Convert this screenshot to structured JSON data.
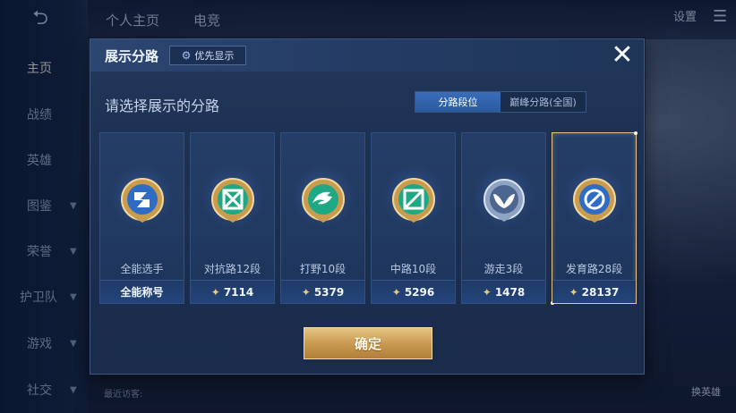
{
  "sidebar": {
    "items": [
      {
        "label": "主页",
        "active": true
      },
      {
        "label": "战绩"
      },
      {
        "label": "英雄"
      },
      {
        "label": "图鉴"
      },
      {
        "label": "荣誉"
      },
      {
        "label": "护卫队"
      },
      {
        "label": "游戏"
      },
      {
        "label": "社交"
      }
    ]
  },
  "top": {
    "tabs": [
      "个人主页",
      "电竞"
    ],
    "settings": "设置",
    "swap_hero": "换英雄",
    "visitors": "最近访客:"
  },
  "modal": {
    "title": "展示分路",
    "priority_label": "优先显示",
    "close_icon": "close-icon",
    "subtitle": "请选择展示的分路",
    "segment": {
      "options": [
        "分路段位",
        "巅峰分路(全国)"
      ],
      "selected": "分路段位"
    },
    "lanes": [
      {
        "name": "全能选手",
        "footer": "全能称号",
        "has_star": false,
        "icon": "allround-badge-icon",
        "color": "#3a78d0"
      },
      {
        "name": "对抗路12段",
        "footer": "7114",
        "has_star": true,
        "icon": "clash-lane-badge-icon",
        "color": "#23b08e"
      },
      {
        "name": "打野10段",
        "footer": "5379",
        "has_star": true,
        "icon": "jungle-badge-icon",
        "color": "#23b08e"
      },
      {
        "name": "中路10段",
        "footer": "5296",
        "has_star": true,
        "icon": "mid-lane-badge-icon",
        "color": "#23b08e"
      },
      {
        "name": "游走3段",
        "footer": "1478",
        "has_star": true,
        "icon": "roam-badge-icon",
        "color": "#6f86a8"
      },
      {
        "name": "发育路28段",
        "footer": "28137",
        "has_star": true,
        "icon": "farm-lane-badge-icon",
        "color": "#3a78d0",
        "selected": true
      }
    ],
    "confirm_label": "确定"
  },
  "colors": {
    "accent_gold": "#e7c58a",
    "segment_active": "#2f61ad",
    "modal_bg": "#1d3052"
  }
}
